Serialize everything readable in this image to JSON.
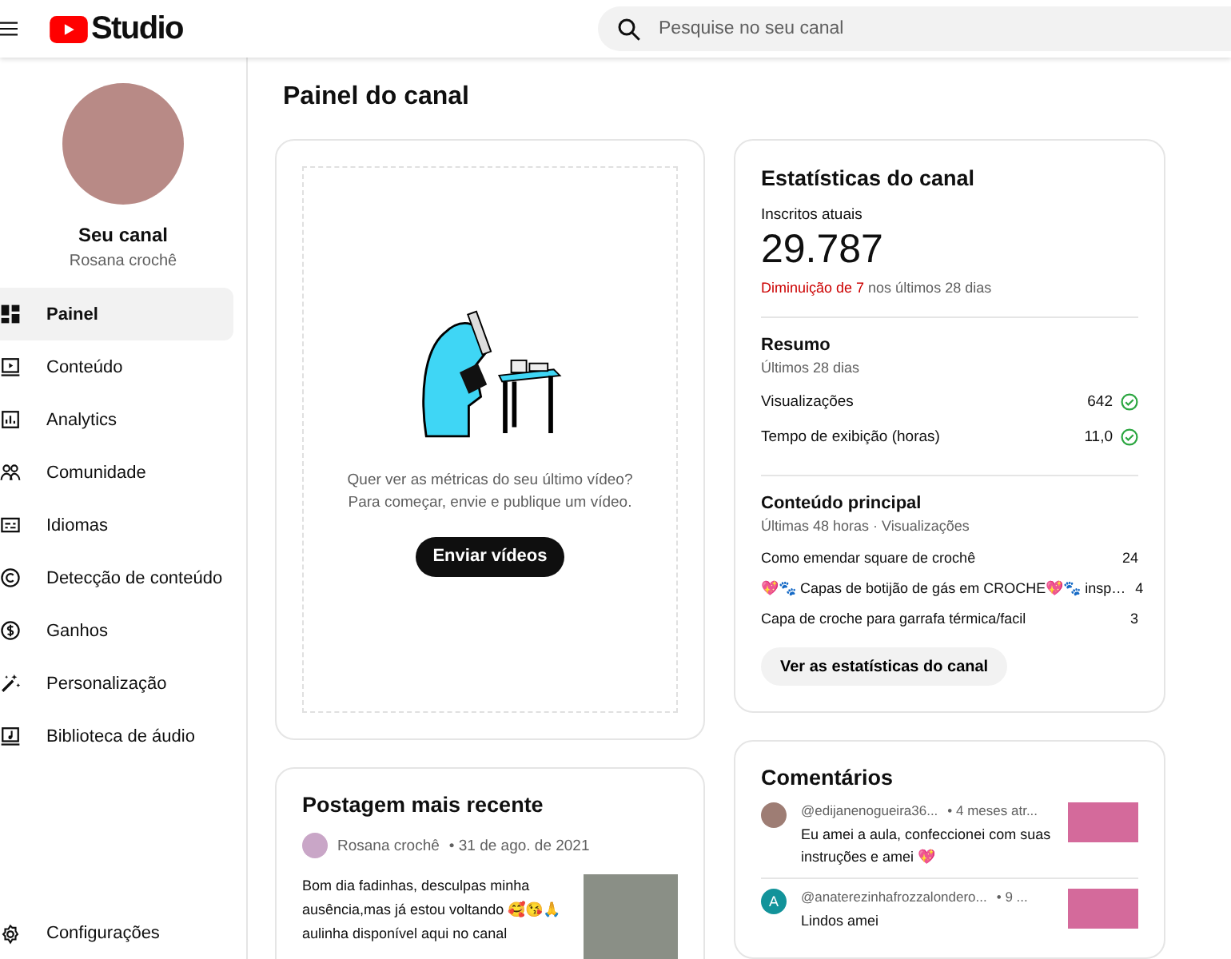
{
  "header": {
    "logo_text": "Studio",
    "search_placeholder": "Pesquise no seu canal"
  },
  "sidebar": {
    "channel_label": "Seu canal",
    "channel_name": "Rosana crochê",
    "items": [
      {
        "label": "Painel",
        "selected": true
      },
      {
        "label": "Conteúdo",
        "selected": false
      },
      {
        "label": "Analytics",
        "selected": false
      },
      {
        "label": "Comunidade",
        "selected": false
      },
      {
        "label": "Idiomas",
        "selected": false
      },
      {
        "label": "Detecção de conteúdo",
        "selected": false
      },
      {
        "label": "Ganhos",
        "selected": false
      },
      {
        "label": "Personalização",
        "selected": false
      },
      {
        "label": "Biblioteca de áudio",
        "selected": false
      }
    ],
    "footer_item": {
      "label": "Configurações"
    }
  },
  "page_title": "Painel do canal",
  "video_card": {
    "message_lines": [
      "Quer ver as métricas do seu último vídeo?",
      "Para começar, envie e publique um vídeo."
    ],
    "button": "Enviar vídeos"
  },
  "stats": {
    "title": "Estatísticas do canal",
    "subscribers_label": "Inscritos atuais",
    "subscribers_value": "29.787",
    "change_highlight": "Diminuição de 7",
    "change_rest": "nos últimos 28 dias",
    "summary": {
      "title": "Resumo",
      "period": "Últimos 28 dias",
      "metrics": [
        {
          "label": "Visualizações",
          "value": "642"
        },
        {
          "label": "Tempo de exibição (horas)",
          "value": "11,0"
        }
      ]
    },
    "top_content": {
      "title": "Conteúdo principal",
      "period": "Últimas 48 horas · Visualizações",
      "items": [
        {
          "title": "Como emendar square de crochê",
          "views": "24"
        },
        {
          "title": "💖🐾 Capas de botijão de gás em CROCHE💖🐾 insp…",
          "views": "4"
        },
        {
          "title": "Capa de croche para garrafa térmica/facil",
          "views": "3"
        }
      ]
    },
    "button": "Ver as estatísticas do canal"
  },
  "post": {
    "title": "Postagem mais recente",
    "author": "Rosana crochê",
    "date": "• 31 de ago. de 2021",
    "text": "Bom dia fadinhas, desculpas minha ausência,mas já estou voltando 🥰😘🙏 aulinha disponível aqui no canal"
  },
  "comments": {
    "title": "Comentários",
    "items": [
      {
        "kind": "photo",
        "author": "@edijanenogueira36...",
        "time": "• 4 meses atr...",
        "text": "Eu amei a aula, confeccionei com suas instruções e amei 💖"
      },
      {
        "kind": "letter",
        "avatar_letter": "A",
        "author": "@anaterezinhafrozzalondero...",
        "time": "• 9 ...",
        "text": "Lindos amei"
      }
    ]
  }
}
